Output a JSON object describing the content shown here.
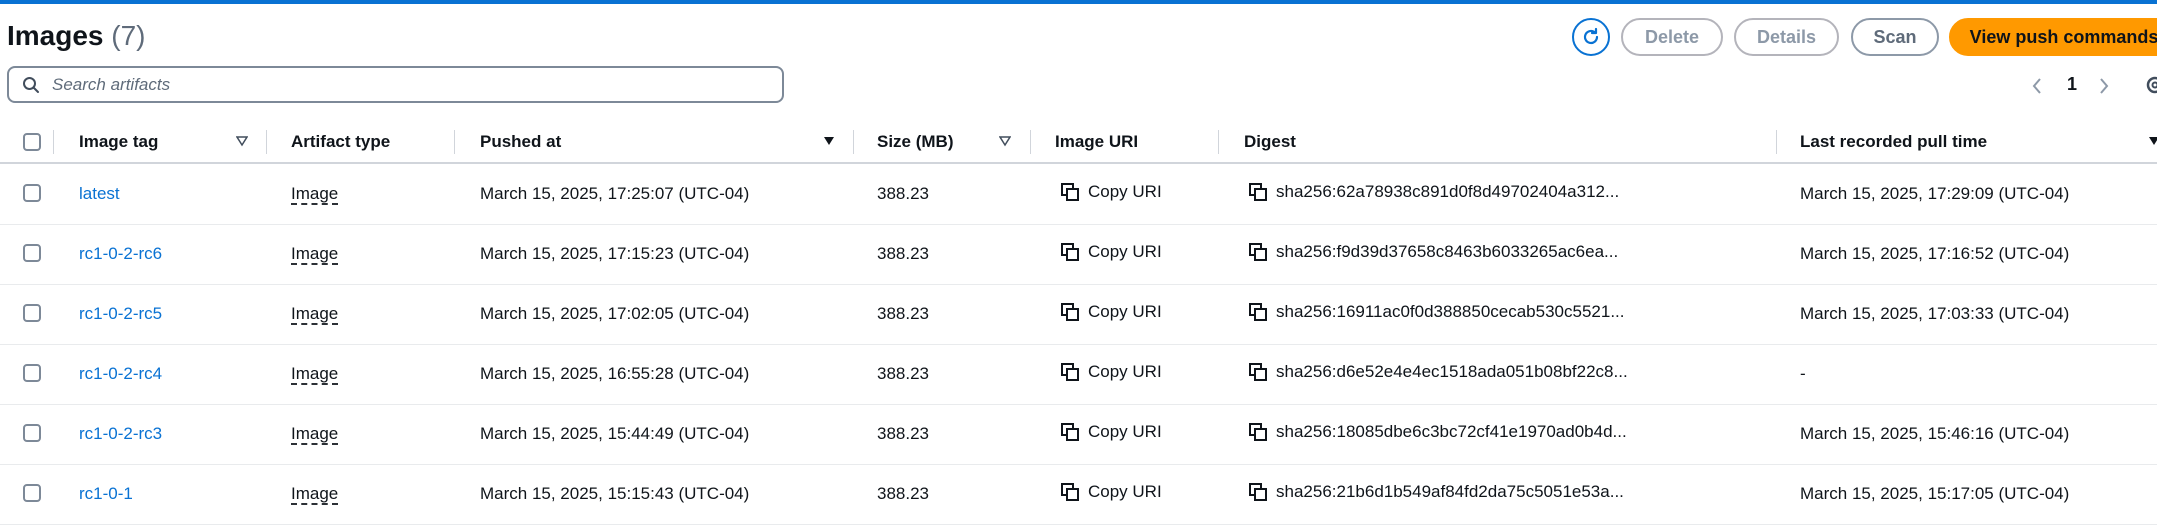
{
  "header": {
    "title": "Images",
    "count": "(7)",
    "buttons": {
      "delete": "Delete",
      "details": "Details",
      "scan": "Scan",
      "view_push": "View push commands"
    }
  },
  "search": {
    "placeholder": "Search artifacts"
  },
  "pagination": {
    "current_page": "1"
  },
  "columns": {
    "image_tag": "Image tag",
    "artifact_type": "Artifact type",
    "pushed_at": "Pushed at",
    "size": "Size (MB)",
    "image_uri": "Image URI",
    "digest": "Digest",
    "last_pull": "Last recorded pull time"
  },
  "rows": [
    {
      "tag": "latest",
      "type": "Image",
      "pushed": "March 15, 2025, 17:25:07 (UTC-04)",
      "size": "388.23",
      "uri": "Copy URI",
      "digest": "sha256:62a78938c891d0f8d49702404a312...",
      "last_pull": "March 15, 2025, 17:29:09 (UTC-04)"
    },
    {
      "tag": "rc1-0-2-rc6",
      "type": "Image",
      "pushed": "March 15, 2025, 17:15:23 (UTC-04)",
      "size": "388.23",
      "uri": "Copy URI",
      "digest": "sha256:f9d39d37658c8463b6033265ac6ea...",
      "last_pull": "March 15, 2025, 17:16:52 (UTC-04)"
    },
    {
      "tag": "rc1-0-2-rc5",
      "type": "Image",
      "pushed": "March 15, 2025, 17:02:05 (UTC-04)",
      "size": "388.23",
      "uri": "Copy URI",
      "digest": "sha256:16911ac0f0d388850cecab530c5521...",
      "last_pull": "March 15, 2025, 17:03:33 (UTC-04)"
    },
    {
      "tag": "rc1-0-2-rc4",
      "type": "Image",
      "pushed": "March 15, 2025, 16:55:28 (UTC-04)",
      "size": "388.23",
      "uri": "Copy URI",
      "digest": "sha256:d6e52e4e4ec1518ada051b08bf22c8...",
      "last_pull": "-"
    },
    {
      "tag": "rc1-0-2-rc3",
      "type": "Image",
      "pushed": "March 15, 2025, 15:44:49 (UTC-04)",
      "size": "388.23",
      "uri": "Copy URI",
      "digest": "sha256:18085dbe6c3bc72cf41e1970ad0b4d...",
      "last_pull": "March 15, 2025, 15:46:16 (UTC-04)"
    },
    {
      "tag": "rc1-0-1",
      "type": "Image",
      "pushed": "March 15, 2025, 15:15:43 (UTC-04)",
      "size": "388.23",
      "uri": "Copy URI",
      "digest": "sha256:21b6d1b549af84fd2da75c5051e53a...",
      "last_pull": "March 15, 2025, 15:17:05 (UTC-04)"
    }
  ],
  "icons": {
    "refresh": "refresh-icon",
    "search": "search-icon",
    "prev": "chevron-left-icon",
    "next": "chevron-right-icon",
    "settings": "gear-icon",
    "copy": "copy-icon",
    "sort": "caret-down-icon"
  },
  "colors": {
    "accent": "#0972d3",
    "primary_button": "#ff9900",
    "text": "#0f141a"
  }
}
